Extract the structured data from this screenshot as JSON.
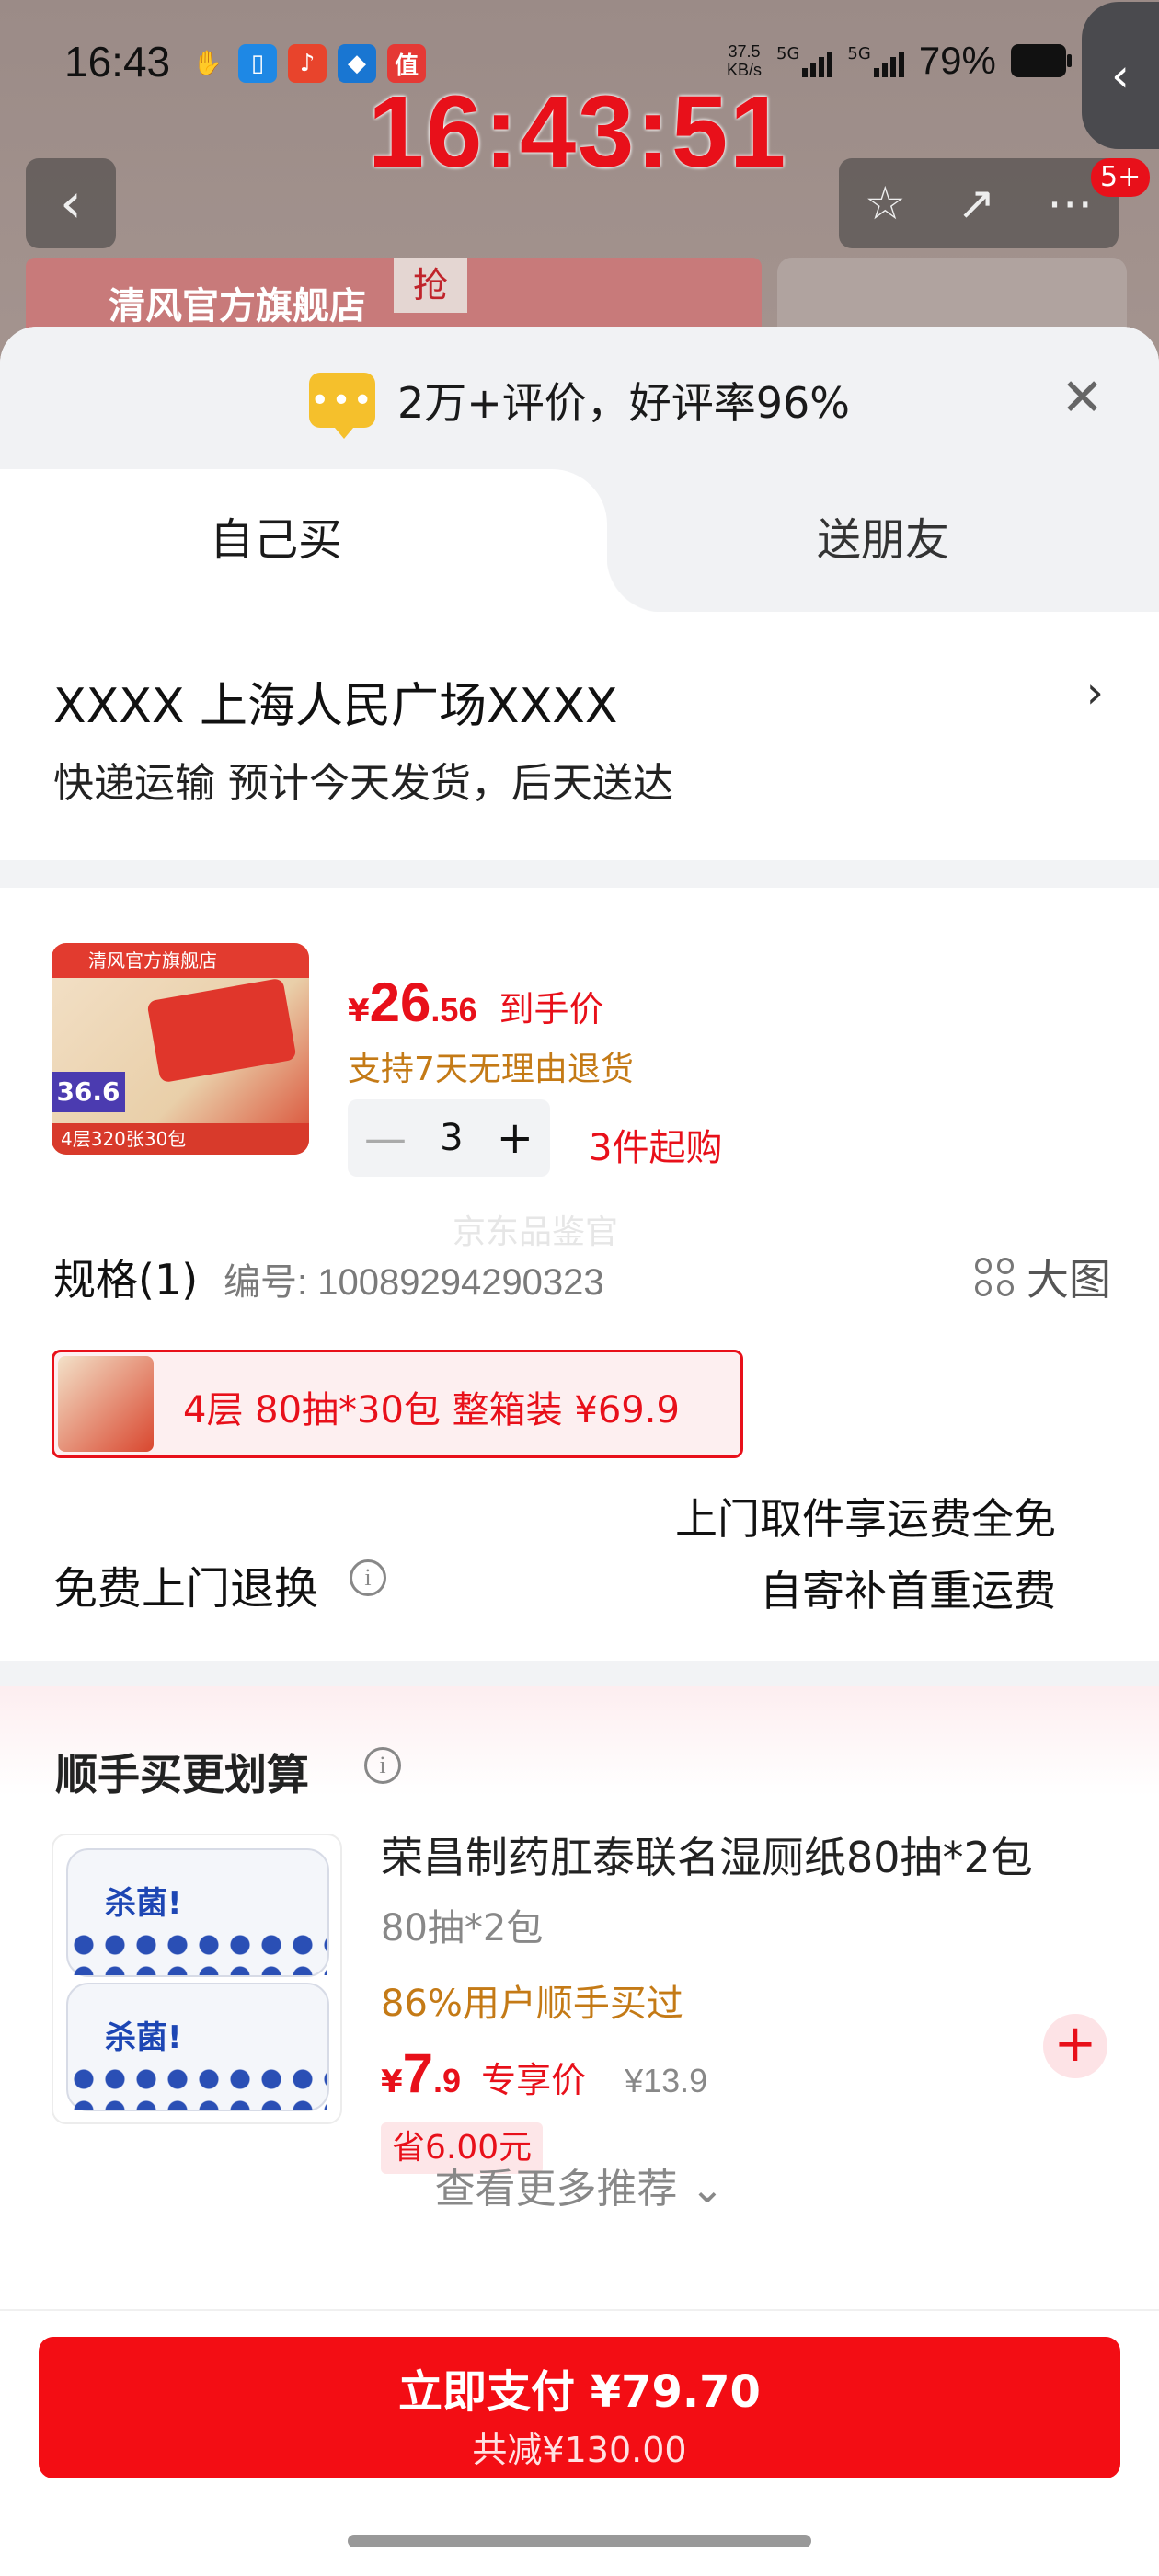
{
  "status": {
    "time": "16:43",
    "net_speed_top": "37.5",
    "net_speed_bottom": "KB/s",
    "sig1": "5G",
    "sig2": "5G",
    "battery": "79%",
    "app_icons": [
      "handshake-icon",
      "phone-clone-icon",
      "qq-music-icon",
      "xiaohongshu-icon",
      "smzdm-icon"
    ]
  },
  "overlay": {
    "clock": "16:43:51"
  },
  "background": {
    "store_name": "清风官方旗舰店",
    "store_tag": "抢",
    "badge": "5+"
  },
  "sheet": {
    "review_text": "2万+评价，好评率96%",
    "tabs": [
      "自己买",
      "送朋友"
    ],
    "address": "XXXX  上海人民广场XXXX",
    "delivery": "快递运输 预计今天发货，后天送达"
  },
  "product": {
    "currency": "¥",
    "price_int": "26",
    "price_dec": ".56",
    "price_tag": "到手价",
    "return_policy": "支持7天无理由退货",
    "quantity": "3",
    "min_buy": "3件起购",
    "watermark": "京东品鉴官",
    "img_top": "清风官方旗舰店",
    "img_badge": "36.6",
    "img_foot": "4层320张30包"
  },
  "spec": {
    "title": "规格(1)",
    "number": "编号: 10089294290323",
    "big_image": "大图",
    "sku_label": "4层 80抽*30包  整箱装    ¥69.9"
  },
  "return_service": {
    "title": "免费上门退换",
    "line1": "上门取件享运费全免",
    "line2": "自寄补首重运费"
  },
  "recommend": {
    "title": "顺手买更划算",
    "name": "荣昌制药肛泰联名湿厕纸80抽*2包",
    "spec": "80抽*2包",
    "buy_pct": "86%用户顺手买过",
    "currency": "¥",
    "price_int": "7",
    "price_dec": ".9",
    "price_tag": "专享价",
    "orig_price": "¥13.9",
    "save": "省6.00元",
    "pack_label": "杀菌!",
    "more": "查看更多推荐 ⌄"
  },
  "pay": {
    "main": "立即支付 ¥79.70",
    "sub": "共减¥130.00"
  },
  "colors": {
    "accent": "#e8101a",
    "pay_button": "#f30d14",
    "orange": "#c47a16"
  }
}
